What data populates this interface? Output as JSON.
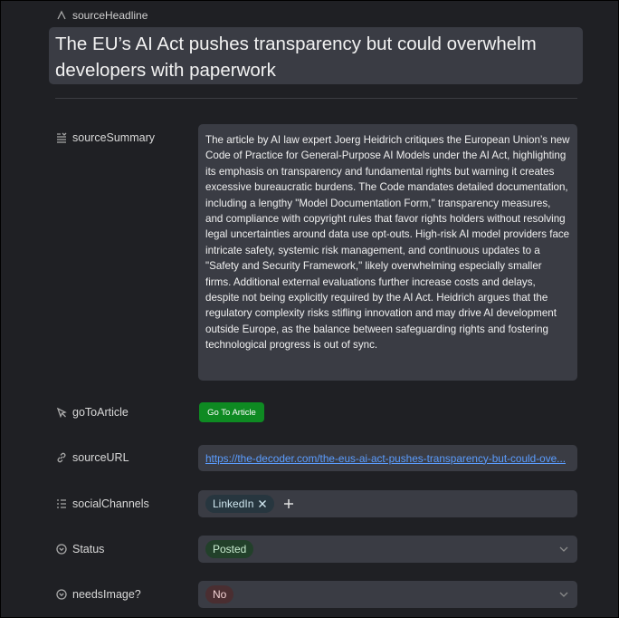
{
  "source_headline": {
    "label": "sourceHeadline",
    "value": "The EU’s AI Act pushes transparency but could overwhelm developers with paperwork"
  },
  "source_summary": {
    "label": "sourceSummary",
    "value": "The article by AI law expert Joerg Heidrich critiques the European Union’s new Code of Practice for General-Purpose AI Models under the AI Act, highlighting its emphasis on transparency and fundamental rights but warning it creates excessive bureaucratic burdens. The Code mandates detailed documentation, including a lengthy \"Model Documentation Form,\" transparency measures, and compliance with copyright rules that favor rights holders without resolving legal uncertainties around data use opt-outs. High-risk AI model providers face intricate safety, systemic risk management, and continuous updates to a \"Safety and Security Framework,\" likely overwhelming especially smaller firms. Additional external evaluations further increase costs and delays, despite not being explicitly required by the AI Act. Heidrich argues that the regulatory complexity risks stifling innovation and may drive AI development outside Europe, as the balance between safeguarding rights and fostering technological progress is out of sync."
  },
  "go_to_article": {
    "label": "goToArticle",
    "button_label": "Go To Article"
  },
  "source_url": {
    "label": "sourceURL",
    "value": "https://the-decoder.com/the-eus-ai-act-pushes-transparency-but-could-ove..."
  },
  "social_channels": {
    "label": "socialChannels",
    "items": [
      "LinkedIn"
    ]
  },
  "status": {
    "label": "Status",
    "value": "Posted"
  },
  "needs_image": {
    "label": "needsImage?",
    "value": "No"
  },
  "colors": {
    "background": "#1f2024",
    "field": "#3a3c44",
    "button_green": "#0e8a22",
    "link": "#5b9dff",
    "posted_tag": "#22402a",
    "no_tag": "#4a2e31",
    "linkedin_tag": "#27363f"
  },
  "icons": {
    "source_headline": "text-a-icon",
    "source_summary": "long-text-icon",
    "go_to_article": "cursor-click-icon",
    "source_url": "link-icon",
    "social_channels": "multi-select-list-icon",
    "status": "select-chevron-icon",
    "needs_image": "select-chevron-icon"
  }
}
